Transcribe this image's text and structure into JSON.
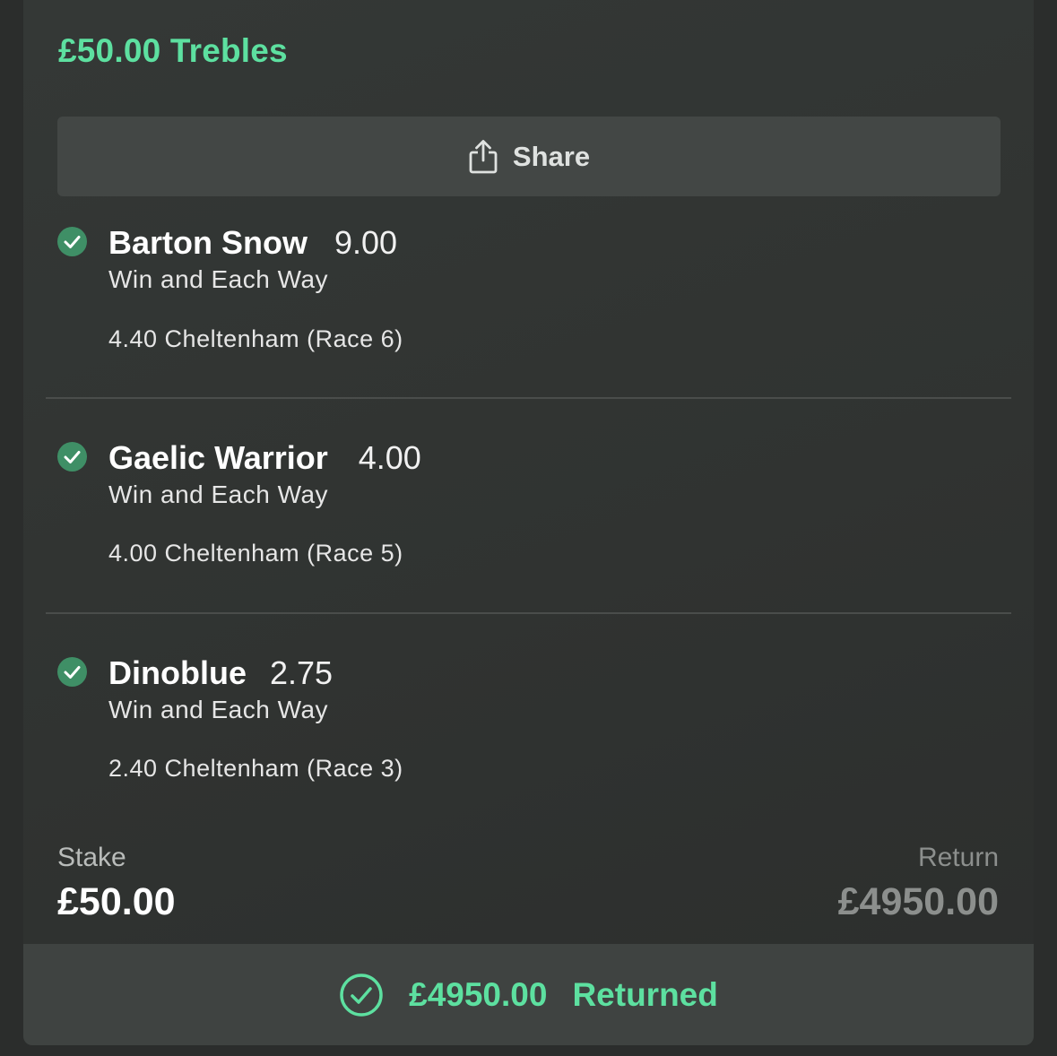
{
  "bet": {
    "title": "£50.00 Trebles",
    "share_label": "Share"
  },
  "selections": [
    {
      "name": "Barton Snow",
      "odds": "9.00",
      "market": "Win and Each Way",
      "event": "4.40 Cheltenham (Race 6)",
      "status_icon": "check-circle-icon"
    },
    {
      "name": "Gaelic Warrior",
      "odds": "4.00",
      "market": "Win and Each Way",
      "event": "4.00 Cheltenham (Race 5)",
      "status_icon": "check-circle-icon"
    },
    {
      "name": "Dinoblue",
      "odds": "2.75",
      "market": "Win and Each Way",
      "event": "2.40 Cheltenham (Race 3)",
      "status_icon": "check-circle-icon"
    }
  ],
  "summary": {
    "stake_label": "Stake",
    "stake_value": "£50.00",
    "return_label": "Return",
    "return_value": "£4950.00"
  },
  "result": {
    "amount": "£4950.00",
    "label": "Returned",
    "icon": "check-circle-outline-icon"
  },
  "colors": {
    "accent": "#5de0a0",
    "check_fill": "#3f8f66",
    "background": "#303331"
  }
}
